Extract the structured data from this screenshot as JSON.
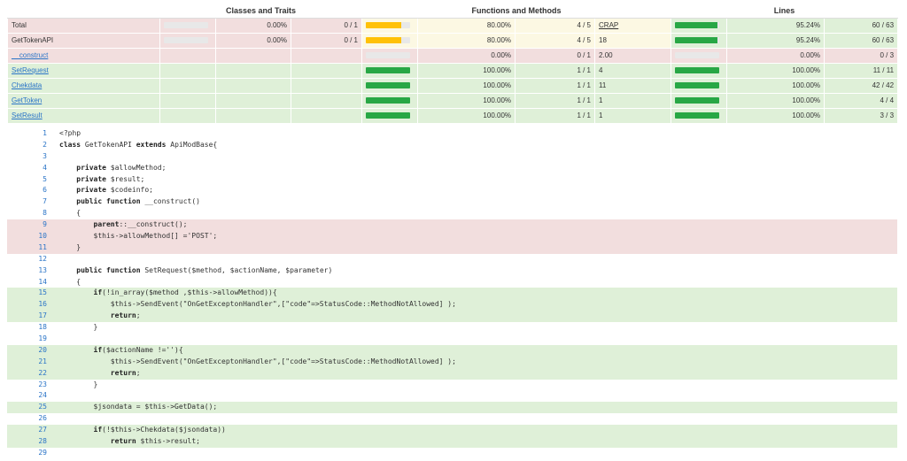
{
  "headers": {
    "classes": "Classes and Traits",
    "functions": "Functions and Methods",
    "lines": "Lines"
  },
  "colors": {
    "success_bar": "#28a745",
    "warning_bar": "#ffc107",
    "danger_row": "#f2dede",
    "success_row": "#dff0d8",
    "warning_row": "#fcf8e3"
  },
  "rows": [
    {
      "name": "Total",
      "link": false,
      "rowclass": "danger",
      "cls_bar": 0,
      "cls_bar_color": "#28a745",
      "cls_pct": "0.00%",
      "cls_cnt": "0 / 1",
      "fn_bar": 0.8,
      "fn_bar_color": "#ffc107",
      "fn_pct": "80.00%",
      "fn_cnt": "4 / 5",
      "crap": "CRAP",
      "fn_class": "warning",
      "ln_bar": 0.9524,
      "ln_bar_color": "#28a745",
      "ln_pct": "95.24%",
      "ln_cnt": "60 / 63",
      "ln_class": "success"
    },
    {
      "name": "GetTokenAPI",
      "link": false,
      "rowclass": "danger",
      "cls_bar": 0,
      "cls_bar_color": "#28a745",
      "cls_pct": "0.00%",
      "cls_cnt": "0 / 1",
      "fn_bar": 0.8,
      "fn_bar_color": "#ffc107",
      "fn_pct": "80.00%",
      "fn_cnt": "4 / 5",
      "crap": "18",
      "fn_class": "warning",
      "ln_bar": 0.9524,
      "ln_bar_color": "#28a745",
      "ln_pct": "95.24%",
      "ln_cnt": "60 / 63",
      "ln_class": "success"
    },
    {
      "name": "__construct",
      "link": true,
      "rowclass": "danger",
      "cls_bar": null,
      "cls_pct": "",
      "cls_cnt": "",
      "fn_bar": 0,
      "fn_bar_color": "#28a745",
      "fn_pct": "0.00%",
      "fn_cnt": "0 / 1",
      "crap": "2.00",
      "fn_class": "danger",
      "ln_bar": 0,
      "ln_bar_color": "#28a745",
      "ln_pct": "0.00%",
      "ln_cnt": "0 / 3",
      "ln_class": "danger"
    },
    {
      "name": "SetRequest",
      "link": true,
      "rowclass": "success",
      "cls_bar": null,
      "cls_pct": "",
      "cls_cnt": "",
      "fn_bar": 1,
      "fn_bar_color": "#28a745",
      "fn_pct": "100.00%",
      "fn_cnt": "1 / 1",
      "crap": "4",
      "fn_class": "success",
      "ln_bar": 1,
      "ln_bar_color": "#28a745",
      "ln_pct": "100.00%",
      "ln_cnt": "11 / 11",
      "ln_class": "success"
    },
    {
      "name": "Chekdata",
      "link": true,
      "rowclass": "success",
      "cls_bar": null,
      "cls_pct": "",
      "cls_cnt": "",
      "fn_bar": 1,
      "fn_bar_color": "#28a745",
      "fn_pct": "100.00%",
      "fn_cnt": "1 / 1",
      "crap": "11",
      "fn_class": "success",
      "ln_bar": 1,
      "ln_bar_color": "#28a745",
      "ln_pct": "100.00%",
      "ln_cnt": "42 / 42",
      "ln_class": "success"
    },
    {
      "name": "GetToken",
      "link": true,
      "rowclass": "success",
      "cls_bar": null,
      "cls_pct": "",
      "cls_cnt": "",
      "fn_bar": 1,
      "fn_bar_color": "#28a745",
      "fn_pct": "100.00%",
      "fn_cnt": "1 / 1",
      "crap": "1",
      "fn_class": "success",
      "ln_bar": 1,
      "ln_bar_color": "#28a745",
      "ln_pct": "100.00%",
      "ln_cnt": "4 / 4",
      "ln_class": "success"
    },
    {
      "name": "SetResult",
      "link": true,
      "rowclass": "success",
      "cls_bar": null,
      "cls_pct": "",
      "cls_cnt": "",
      "fn_bar": 1,
      "fn_bar_color": "#28a745",
      "fn_pct": "100.00%",
      "fn_cnt": "1 / 1",
      "crap": "1",
      "fn_class": "success",
      "ln_bar": 1,
      "ln_bar_color": "#28a745",
      "ln_pct": "100.00%",
      "ln_cnt": "3 / 3",
      "ln_class": "success"
    }
  ],
  "code": [
    {
      "n": "1",
      "t": "<?php",
      "c": ""
    },
    {
      "n": "2",
      "t": "class GetTokenAPI extends ApiModBase{",
      "c": ""
    },
    {
      "n": "3",
      "t": "",
      "c": ""
    },
    {
      "n": "4",
      "t": "    private $allowMethod;",
      "c": ""
    },
    {
      "n": "5",
      "t": "    private $result;",
      "c": ""
    },
    {
      "n": "6",
      "t": "    private $codeinfo;",
      "c": ""
    },
    {
      "n": "7",
      "t": "    public function __construct()",
      "c": ""
    },
    {
      "n": "8",
      "t": "    {",
      "c": ""
    },
    {
      "n": "9",
      "t": "        parent::__construct();",
      "c": "red"
    },
    {
      "n": "10",
      "t": "        $this->allowMethod[] ='POST';",
      "c": "red"
    },
    {
      "n": "11",
      "t": "    }",
      "c": "red"
    },
    {
      "n": "12",
      "t": "",
      "c": ""
    },
    {
      "n": "13",
      "t": "    public function SetRequest($method, $actionName, $parameter)",
      "c": ""
    },
    {
      "n": "14",
      "t": "    {",
      "c": ""
    },
    {
      "n": "15",
      "t": "        if(!in_array($method ,$this->allowMethod)){",
      "c": "green"
    },
    {
      "n": "16",
      "t": "            $this->SendEvent(\"OnGetExceptonHandler\",[\"code\"=>StatusCode::MethodNotAllowed] );",
      "c": "green"
    },
    {
      "n": "17",
      "t": "            return;",
      "c": "green"
    },
    {
      "n": "18",
      "t": "        }",
      "c": ""
    },
    {
      "n": "19",
      "t": "",
      "c": ""
    },
    {
      "n": "20",
      "t": "        if($actionName !=''){",
      "c": "green"
    },
    {
      "n": "21",
      "t": "            $this->SendEvent(\"OnGetExceptonHandler\",[\"code\"=>StatusCode::MethodNotAllowed] );",
      "c": "green"
    },
    {
      "n": "22",
      "t": "            return;",
      "c": "green"
    },
    {
      "n": "23",
      "t": "        }",
      "c": ""
    },
    {
      "n": "24",
      "t": "",
      "c": ""
    },
    {
      "n": "25",
      "t": "        $jsondata = $this->GetData();",
      "c": "green"
    },
    {
      "n": "26",
      "t": "",
      "c": ""
    },
    {
      "n": "27",
      "t": "        if(!$this->Chekdata($jsondata))",
      "c": "green"
    },
    {
      "n": "28",
      "t": "            return $this->result;",
      "c": "green"
    },
    {
      "n": "29",
      "t": "",
      "c": ""
    }
  ]
}
